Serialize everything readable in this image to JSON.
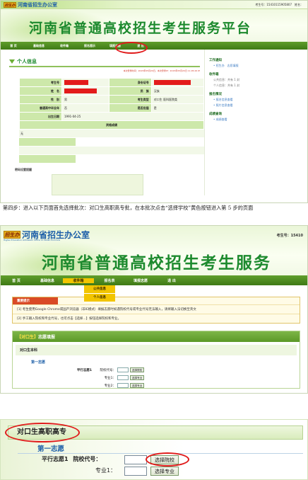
{
  "shot1": {
    "logo_badge": "招生办",
    "logo_text": "河南省招生办公室",
    "top_right": "考生号：15410115905807　姓名：",
    "site_title": "河南省普通高校招生考生服务平台",
    "nav": [
      "首 页",
      "基础信息",
      "收件箱",
      "报名提示",
      "填报志愿",
      "退 出"
    ],
    "section_title": "个人信息",
    "update_info": "本次登录时间：2015年05月20日，本次登录IP：2015年05月20日 11:05:26 IE",
    "table": {
      "r1": [
        "考生号",
        "",
        "身份证号",
        ""
      ],
      "r2": [
        "姓　名",
        "",
        "民　族",
        "汉族"
      ],
      "r3": [
        "性　别",
        "男",
        "考生类型",
        "对口生 医科医院类"
      ],
      "r4": [
        "普通高中毕业年",
        "否",
        "是否应届",
        "是"
      ],
      "r5": [
        "出生日期",
        "1991-04-25"
      ],
      "score_header": "资格成绩"
    },
    "score_row1": "无",
    "password_label": "密码设置提醒",
    "sidebar": {
      "h1": "工作通知",
      "i1": "• 招生办　志愿填报",
      "h2": "收件箱",
      "i2a": "公共信息：共有 1 封",
      "i2b": "个人信息：共有 1 封",
      "h3": "报名情况",
      "i3a": "• 报名信息查看",
      "i3b": "• 照片信息查看",
      "h4": "成绩查询",
      "i4": "• 成绩查看"
    }
  },
  "caption": "第四步：进入以下页面首先选择批次：对口生高职高专批，在本批次点击“选择学校”黄色按钮进入第 5 步的页面",
  "shot2": {
    "logo_badge": "招生办",
    "logo_text": "河南省招生办公室",
    "logo_sub": "Higher Education Admission Office of Henan Province",
    "top_right": "考生号：15410",
    "site_title": "河南省普通高校招生考生服务",
    "nav": [
      "首 页",
      "基础信息",
      "收件箱",
      "报名表",
      "填报志愿",
      "退 出"
    ],
    "dropdown": [
      "公共信息",
      "个人信息"
    ],
    "notice_title": "重要提示",
    "notice_lines": [
      "[1] 考生使用Google Chrome或国产浏览器（非IE模式）填报志愿时如遇院校代号或专业代号无法输入，请将输入法切换至英文",
      "[2] 手工输入院校和专业代号，也可点击【选择...】按钮选择院校和专业。"
    ],
    "panel_title_red": "【对口生】",
    "panel_title": "志愿填报",
    "batch": "对口生本科",
    "first_choice": "第一志愿",
    "parallel_label": "平行志愿1",
    "school_code": "院校代号：",
    "major1": "专业1：",
    "major2": "专业2：",
    "select_school": "选择院校",
    "select_major": "选择专业"
  },
  "shot3": {
    "batch_title": "对口生高职高专",
    "first_choice": "第一志愿",
    "parallel_label": "平行志愿1",
    "school_code": "院校代号：",
    "major1": "专业1：",
    "select_school": "选择院校",
    "select_major": "选择专业"
  },
  "colors": {
    "green": "#1d8a2e",
    "nav_green": "#4f8c22",
    "highlight_red": "#e01b1b",
    "active_yellow": "#f2c500"
  }
}
